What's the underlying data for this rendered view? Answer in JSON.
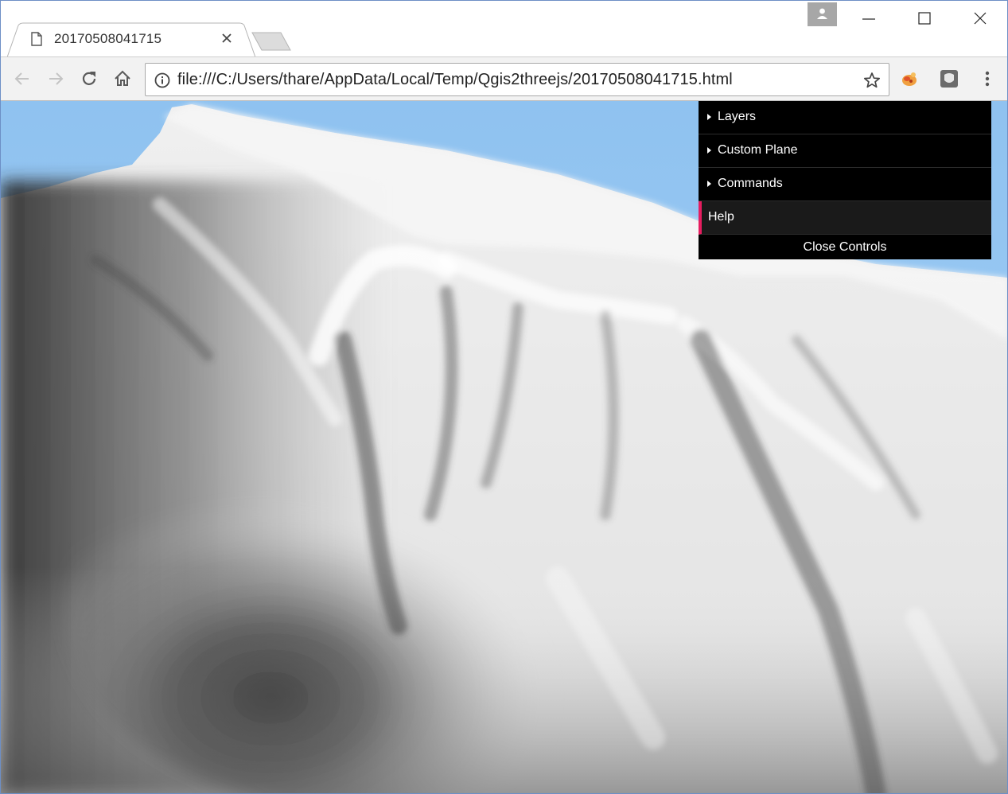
{
  "browser": {
    "tab": {
      "title": "20170508041715",
      "favicon": "page-icon",
      "close": "close-icon"
    },
    "url": "file:///C:/Users/thare/AppData/Local/Temp/Qgis2threejs/20170508041715.html",
    "toolbar": {
      "back": "back-arrow-icon",
      "forward": "forward-arrow-icon",
      "reload": "reload-icon",
      "home": "home-icon",
      "site_info": "info-icon",
      "bookmark": "star-icon",
      "extensions": [
        "extension-icon",
        "extension-icon"
      ],
      "menu": "kebab-menu-icon"
    },
    "window_controls": [
      "minimize-icon",
      "maximize-icon",
      "close-icon"
    ],
    "profile": "person-icon"
  },
  "scene": {
    "type": "3d-terrain-view",
    "sky_color": "#9bc8f2",
    "terrain_light": "#f4f4f4",
    "terrain_dark": "#2a2a2a"
  },
  "controls": {
    "items": [
      {
        "label": "Layers"
      },
      {
        "label": "Custom Plane"
      },
      {
        "label": "Commands"
      }
    ],
    "help_label": "Help",
    "close_label": "Close Controls",
    "accent_color": "#e61d5f"
  }
}
